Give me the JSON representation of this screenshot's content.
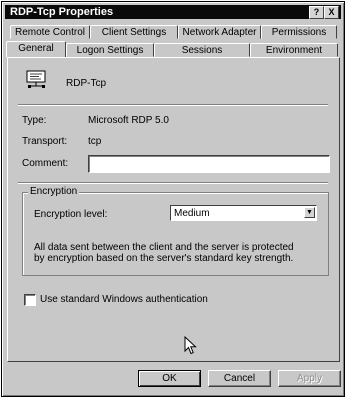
{
  "window": {
    "title": "RDP-Tcp Properties",
    "help_button": "?",
    "close_button": "X"
  },
  "tabs": {
    "row1": [
      "Remote Control",
      "Client Settings",
      "Network Adapter",
      "Permissions"
    ],
    "row2": [
      "General",
      "Logon Settings",
      "Sessions",
      "Environment"
    ],
    "active": "General"
  },
  "general": {
    "connection_name": "RDP-Tcp",
    "type_label": "Type:",
    "type_value": "Microsoft RDP 5.0",
    "transport_label": "Transport:",
    "transport_value": "tcp",
    "comment_label": "Comment:",
    "comment_value": "",
    "encryption": {
      "group_title": "Encryption",
      "level_label": "Encryption level:",
      "level_value": "Medium",
      "description": "All data sent between the client and the server is protected by encryption based on the server's standard key strength."
    },
    "windows_auth_label": "Use standard Windows authentication",
    "windows_auth_checked": false
  },
  "buttons": {
    "ok": "OK",
    "cancel": "Cancel",
    "apply": "Apply"
  }
}
